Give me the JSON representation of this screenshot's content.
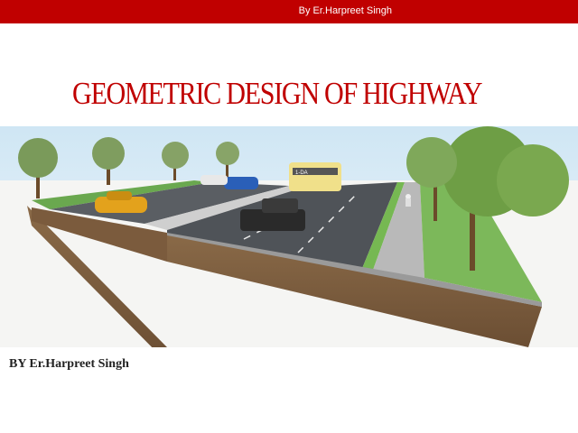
{
  "header": {
    "credit": "By Er.Harpreet Singh",
    "bar_color": "#c00000"
  },
  "slide": {
    "title": "GEOMETRIC DESIGN OF HIGHWAY",
    "title_color": "#c00000",
    "author": "BY Er.Harpreet Singh"
  },
  "illustration": {
    "subject": "highway-cross-section-render",
    "bus_label": "1-DA"
  }
}
